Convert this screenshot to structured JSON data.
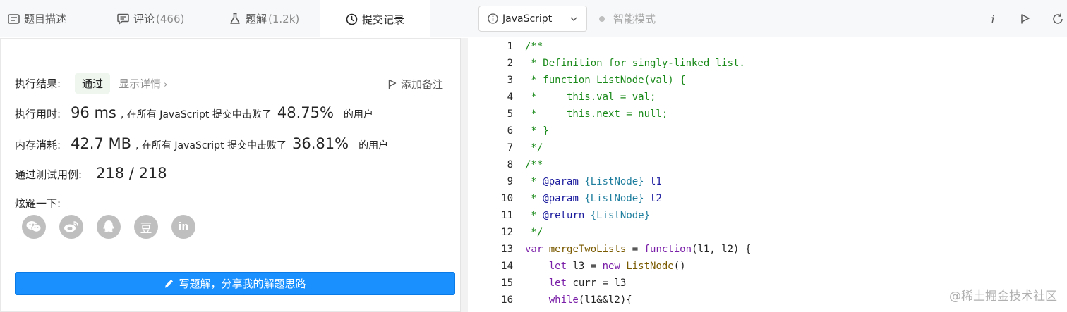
{
  "tabs": [
    {
      "label": "题目描述",
      "count": "",
      "icon": "description-icon"
    },
    {
      "label": "评论",
      "count": "(466)",
      "icon": "comment-icon"
    },
    {
      "label": "题解",
      "count": "(1.2k)",
      "icon": "flask-icon"
    },
    {
      "label": "提交记录",
      "count": "",
      "icon": "clock-icon",
      "active": true
    }
  ],
  "result": {
    "label": "执行结果:",
    "status": "通过",
    "detail": "显示详情",
    "note_button": "添加备注"
  },
  "runtime": {
    "label": "执行用时:",
    "value": "96 ms",
    "text": ", 在所有 JavaScript 提交中击败了",
    "percent": "48.75%",
    "suffix": "的用户"
  },
  "memory": {
    "label": "内存消耗:",
    "value": "42.7 MB",
    "text": ", 在所有 JavaScript 提交中击败了",
    "percent": "36.81%",
    "suffix": "的用户"
  },
  "tests": {
    "label": "通过测试用例:",
    "value": "218 / 218"
  },
  "share": {
    "label": "炫耀一下:",
    "icons": [
      "wechat-icon",
      "weibo-icon",
      "qq-icon",
      "douban-icon",
      "linkedin-icon"
    ],
    "douban_glyph": "豆",
    "linkedin_glyph": "in"
  },
  "write_solution_button": "写题解，分享我的解题思路",
  "editor": {
    "language": "JavaScript",
    "mode": "智能模式",
    "line_numbers": [
      "1",
      "2",
      "3",
      "4",
      "5",
      "6",
      "7",
      "8",
      "9",
      "10",
      "11",
      "12",
      "13",
      "14",
      "15",
      "16"
    ],
    "info_glyph": "i"
  },
  "code": {
    "l1": "/**",
    "l2": " * Definition for singly-linked list.",
    "l3": " * function ListNode(val) {",
    "l4": " *     this.val = val;",
    "l5": " *     this.next = null;",
    "l6": " * }",
    "l7": " */",
    "l8": "/**",
    "l9_a": " * ",
    "l9_tag": "@param",
    "l9_type": "{ListNode}",
    "l9_name": " l1",
    "l10_a": " * ",
    "l10_tag": "@param",
    "l10_type": "{ListNode}",
    "l10_name": " l2",
    "l11_a": " * ",
    "l11_tag": "@return",
    "l11_type": "{ListNode}",
    "l12": " */",
    "l13_kw": "var",
    "l13_name": " mergeTwoLists",
    "l13_eq": " = ",
    "l13_fn": "function",
    "l13_rest": "(l1, l2) {",
    "l14_kw": "    let",
    "l14_a": " l3 = ",
    "l14_new": "new",
    "l14_cls": " ListNode",
    "l14_rest": "()",
    "l15_kw": "    let",
    "l15_rest": " curr = l3",
    "l16_kw": "    while",
    "l16_rest": "(l1&&l2){"
  },
  "watermark": "@稀土掘金技术社区"
}
